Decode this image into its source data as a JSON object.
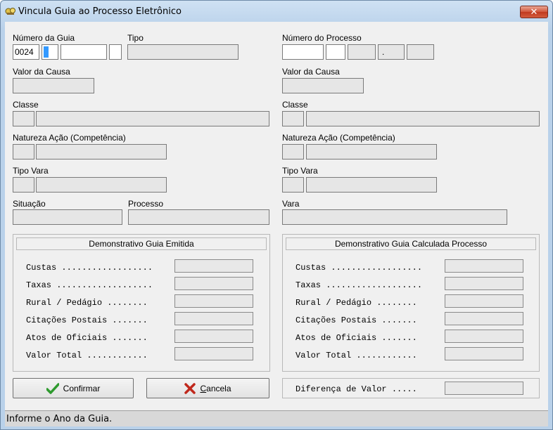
{
  "window": {
    "title": "Vincula Guia ao Processo Eletrônico",
    "close_glyph": "✕"
  },
  "left": {
    "numero_guia_label": "Número da Guia",
    "tipo_label": "Tipo",
    "numero_guia_value": "0024",
    "valor_causa_label": "Valor da Causa",
    "classe_label": "Classe",
    "natureza_label": "Natureza Ação (Competência)",
    "tipo_vara_label": "Tipo Vara",
    "situacao_label": "Situação",
    "processo_label": "Processo"
  },
  "right": {
    "numero_processo_label": "Número do Processo",
    "dot": ".",
    "valor_causa_label": "Valor da Causa",
    "classe_label": "Classe",
    "natureza_label": "Natureza Ação (Competência)",
    "tipo_vara_label": "Tipo Vara",
    "vara_label": "Vara"
  },
  "demo_emitida": {
    "title": "Demonstrativo Guia Emitida",
    "rows": [
      "Custas ..................",
      "Taxas ...................",
      "Rural / Pedágio ........",
      "Citações Postais .......",
      "Atos de Oficiais .......",
      "Valor Total ............"
    ]
  },
  "demo_calculada": {
    "title": "Demonstrativo Guia Calculada Processo",
    "rows": [
      "Custas ..................",
      "Taxas ...................",
      "Rural / Pedágio ........",
      "Citações Postais .......",
      "Atos de Oficiais .......",
      "Valor Total ............"
    ]
  },
  "buttons": {
    "confirmar": "Confirmar",
    "cancela_first": "C",
    "cancela_rest": "ancela"
  },
  "diferenca_label": "Diferença de Valor .....",
  "status_text": "Informe o Ano da Guia.",
  "icons": {
    "window": "app-icon",
    "confirm": "check-icon",
    "cancel": "x-icon"
  },
  "colors": {
    "check": "#2e9a2e",
    "cross": "#c0281c",
    "selection": "#3399ff"
  }
}
